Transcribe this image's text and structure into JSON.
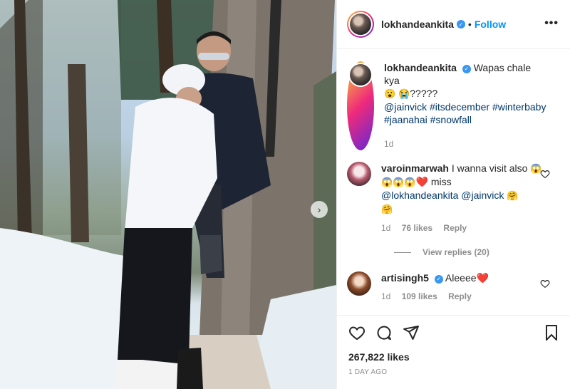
{
  "header": {
    "username": "lokhandeankita",
    "separator": "•",
    "follow_label": "Follow",
    "more_label": "•••"
  },
  "caption": {
    "username": "lokhandeankita",
    "text": "Wapas chale kya",
    "emoji_1": "😮",
    "emoji_2": "😭",
    "question_marks": "?????",
    "mention": "@jainvick",
    "hashtags": [
      "#itsdecember",
      "#winterbaby",
      "#jaanahai",
      "#snowfall"
    ],
    "time": "1d"
  },
  "comments": [
    {
      "username": "varoinmarwah",
      "text_1": "I wanna visit also",
      "emojis_1": "😱😱😱😱",
      "heart": "❤️",
      "text_2": "miss",
      "mention_1": "@lokhandeankita",
      "mention_2": "@jainvick",
      "emoji_a": "🤗",
      "emoji_b": "🤗",
      "time": "1d",
      "likes": "76 likes",
      "reply": "Reply",
      "view_replies": "View replies (20)"
    },
    {
      "username": "artisingh5",
      "text": "Aleeee",
      "heart": "❤️",
      "time": "1d",
      "likes": "109 likes",
      "reply": "Reply"
    }
  ],
  "actions": {
    "likes": "267,822 likes",
    "date": "1 DAY AGO"
  },
  "carousel": {
    "next_glyph": "›"
  },
  "colors": {
    "accent": "#0095f6",
    "verified": "#3897f0",
    "heart": "#ed4956",
    "meta": "#8e8e8e"
  }
}
